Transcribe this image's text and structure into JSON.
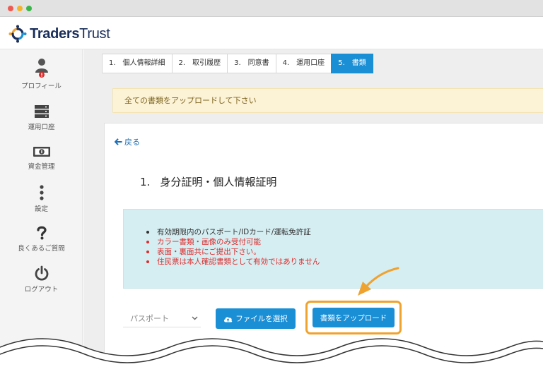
{
  "window": {
    "controls": [
      "close",
      "minimize",
      "zoom"
    ]
  },
  "brand": {
    "name_bold": "Traders",
    "name_light": "Trust",
    "logo_icon": "tradersTrust-logo-icon"
  },
  "sidebar": {
    "items": [
      {
        "label": "プロフィール",
        "icon": "user-icon",
        "badge": "!"
      },
      {
        "label": "運用口座",
        "icon": "server-icon"
      },
      {
        "label": "資金管理",
        "icon": "money-icon"
      },
      {
        "label": "設定",
        "icon": "vertical-dots-icon"
      },
      {
        "label": "良くあるご質問",
        "icon": "question-icon"
      },
      {
        "label": "ログアウト",
        "icon": "power-icon"
      }
    ]
  },
  "tabs": [
    {
      "label": "1.　個人情報詳細",
      "active": false
    },
    {
      "label": "2.　取引履歴",
      "active": false
    },
    {
      "label": "3.　同意書",
      "active": false
    },
    {
      "label": "4.　運用口座",
      "active": false
    },
    {
      "label": "5.　書類",
      "active": true
    }
  ],
  "alert": {
    "text": "全ての書類をアップロードして下さい"
  },
  "card": {
    "back_label": "戻る",
    "section_number": "1.",
    "section_title": "身分証明・個人情報証明",
    "info_items": [
      {
        "text": "有効期限内のパスポート/IDカード/運転免許証",
        "warning": false
      },
      {
        "text": "カラー書類・画像のみ受付可能",
        "warning": true
      },
      {
        "text": "表面・裏面共にご提出下さい。",
        "warning": true
      },
      {
        "text": "住民票は本人確認書類として有効ではありません",
        "warning": true
      }
    ],
    "doc_type_select": {
      "value": "パスポート"
    },
    "choose_file_button": "ファイルを選択",
    "upload_button": "書類をアップロード"
  },
  "colors": {
    "accent": "#1a8fd6",
    "highlight": "#f0a22e",
    "alert_bg": "#fcf2d5",
    "info_bg": "#d5eef2",
    "warning_text": "#e02b2b",
    "brand": "#1a2e5a"
  }
}
